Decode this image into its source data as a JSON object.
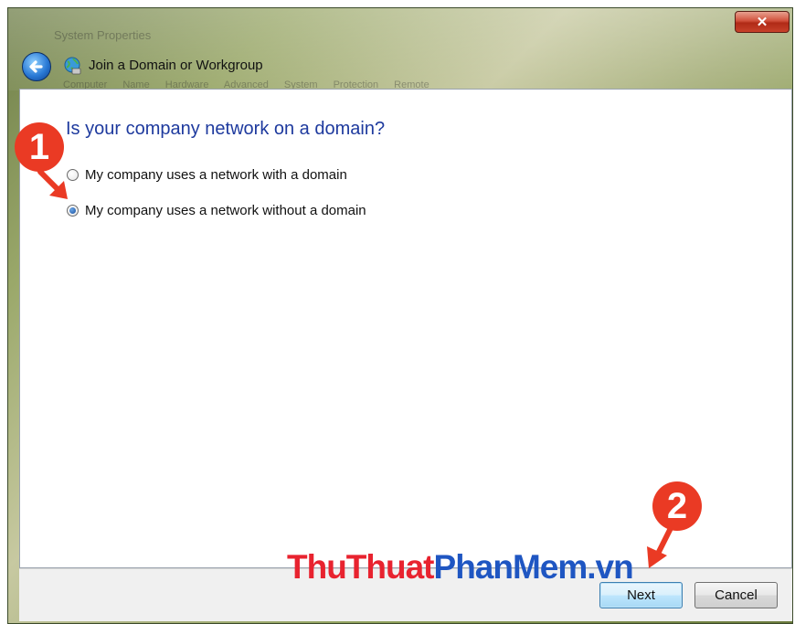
{
  "window": {
    "title": "Join a Domain or Workgroup",
    "close_glyph": "✕",
    "background_title": "System Properties",
    "background_tabs": "Computer Name Hardware Advanced System Protection Remote"
  },
  "content": {
    "question": "Is your company network on a domain?",
    "options": [
      {
        "label": "My company uses a network with a domain",
        "selected": false
      },
      {
        "label": "My company uses a network without a domain",
        "selected": true
      }
    ]
  },
  "buttons": {
    "next": "Next",
    "cancel": "Cancel"
  },
  "annotations": {
    "step1": "1",
    "step2": "2",
    "badge_color": "#ea3a24"
  },
  "watermark": {
    "part1": "ThuThuat",
    "part2": "PhanMem.vn"
  },
  "icons": {
    "back": "back-arrow-icon",
    "wizard": "network-globe-icon",
    "close": "close-icon"
  }
}
